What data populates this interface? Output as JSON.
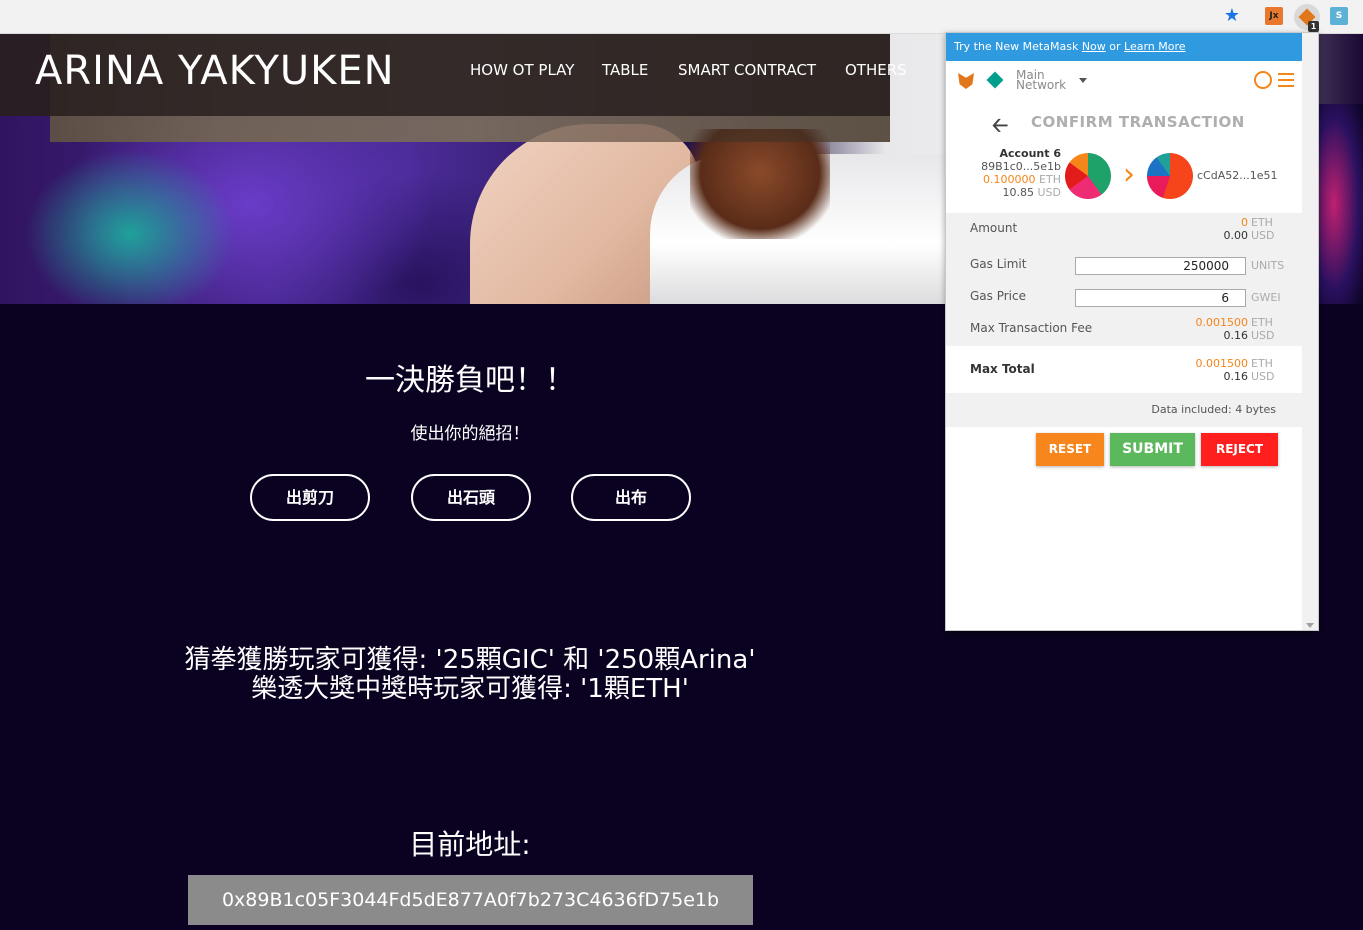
{
  "site": {
    "brand": "ARINA YAKYUKEN",
    "nav": [
      "HOW OT PLAY",
      "TABLE",
      "SMART CONTRACT",
      "OTHERS"
    ]
  },
  "main": {
    "headline": "一決勝負吧！！",
    "subline": "使出你的絕招！",
    "choices": [
      "出剪刀",
      "出石頭",
      "出布"
    ],
    "reward_line1": "猜拳獲勝玩家可獲得: '25顆GIC' 和 '250顆Arina'",
    "reward_line2": "樂透大獎中獎時玩家可獲得: '1顆ETH'",
    "address_label": "目前地址:",
    "address": "0x89B1c05F3044Fd5dE877A0f7b273C4636fD75e1b"
  },
  "metamask": {
    "banner_prefix": "Try the New MetaMask ",
    "banner_now": "Now",
    "banner_or": " or ",
    "banner_learn": "Learn More",
    "network_line1": "Main",
    "network_line2": "Network",
    "title": "CONFIRM TRANSACTION",
    "from": {
      "name": "Account 6",
      "address": "89B1c0...5e1b",
      "eth": "0.100000",
      "eth_unit": "ETH",
      "usd": "10.85",
      "usd_unit": "USD"
    },
    "to_address": "cCdA52...1e51",
    "amount_label": "Amount",
    "amount_eth": "0",
    "amount_usd": "0.00",
    "gas_limit_label": "Gas Limit",
    "gas_limit": "250000",
    "gas_limit_unit": "UNITS",
    "gas_price_label": "Gas Price",
    "gas_price": "6",
    "gas_price_unit": "GWEI",
    "max_fee_label": "Max Transaction Fee",
    "max_fee_eth": "0.001500",
    "max_fee_usd": "0.16",
    "max_total_label": "Max Total",
    "max_total_eth": "0.001500",
    "max_total_usd": "0.16",
    "eth_unit": "ETH",
    "usd_unit": "USD",
    "data_included": "Data included: 4 bytes",
    "reset": "RESET",
    "submit": "SUBMIT",
    "reject": "REJECT"
  },
  "browser": {
    "ext_jx": "Jx",
    "ext_badge": "1",
    "ext_s": "S"
  },
  "colors": {
    "page_bg": "#0a0220",
    "metamask_orange": "#f6851b",
    "submit_green": "#5cb85c",
    "reject_red": "#ff1f1f",
    "banner_blue": "#2f9ae0"
  }
}
